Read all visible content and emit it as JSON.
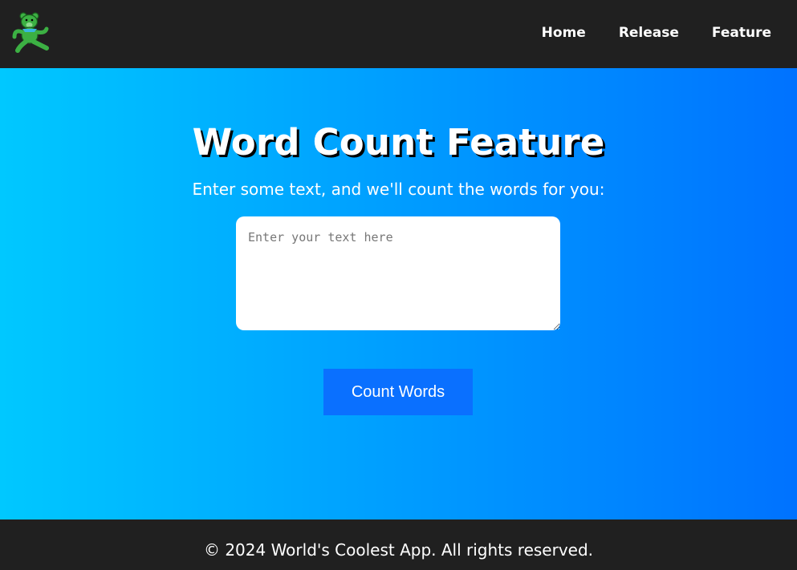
{
  "header": {
    "logo_icon": "dancing-bear-icon",
    "nav": [
      {
        "label": "Home"
      },
      {
        "label": "Release"
      },
      {
        "label": "Feature"
      }
    ]
  },
  "main": {
    "title": "Word Count Feature",
    "subtitle": "Enter some text, and we'll count the words for you:",
    "textarea": {
      "placeholder": "Enter your text here",
      "value": ""
    },
    "button_label": "Count Words"
  },
  "footer": {
    "text": "© 2024 World's Coolest App. All rights reserved."
  },
  "colors": {
    "header_bg": "#202020",
    "gradient_start": "#00c8ff",
    "gradient_end": "#0072ff",
    "button_bg": "#0a70ff",
    "logo_green": "#3cb043"
  }
}
